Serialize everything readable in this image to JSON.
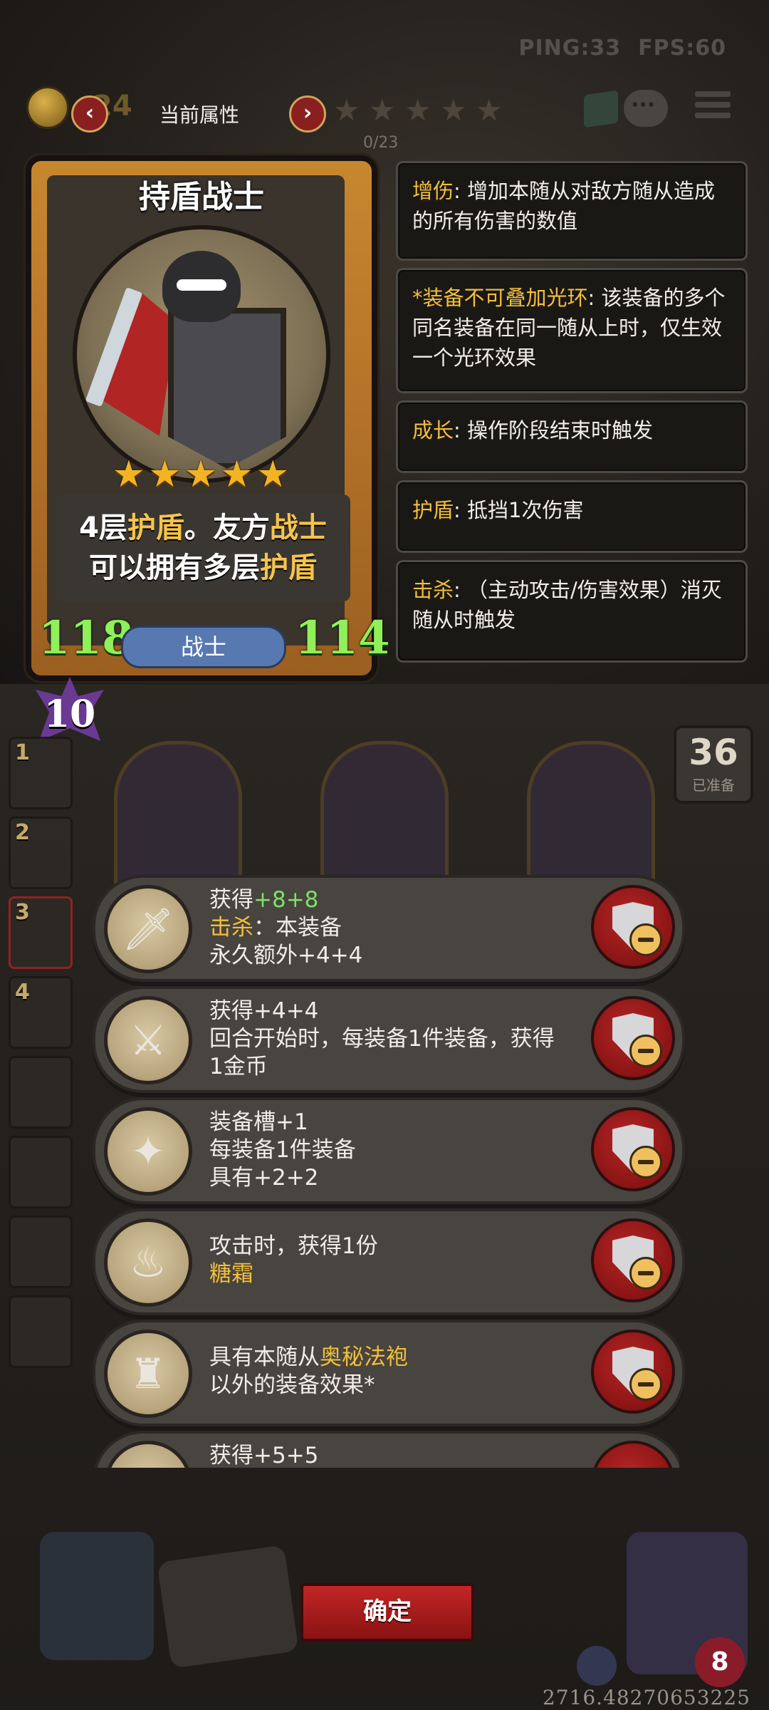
{
  "status": {
    "ping": "PING:33",
    "fps": "FPS:60"
  },
  "header": {
    "gold": "24",
    "title": "当前属性",
    "prev": "‹",
    "next": "›",
    "progress": "0/23"
  },
  "card": {
    "name": "持盾战士",
    "stars": 5,
    "desc_line1": [
      "4层",
      "护盾",
      "。友方",
      "战士"
    ],
    "desc_line2": [
      "可以拥有多层",
      "护盾"
    ],
    "attack": "118",
    "health": "114",
    "class": "战士"
  },
  "keywords": [
    {
      "key": "增伤",
      "text": ": 增加本随从对敌方随从造成的所有伤害的数值"
    },
    {
      "key": "*装备不可叠加光环",
      "text": ": 该装备的多个同名装备在同一随从上时，仅生效一个光环效果"
    },
    {
      "key": "成长",
      "text": ": 操作阶段结束时触发"
    },
    {
      "key": "护盾",
      "text": ": 抵挡1次伤害"
    },
    {
      "key": "击杀",
      "text": ": （主动攻击/伤害效果）消灭随从时触发"
    }
  ],
  "board": {
    "level": "10",
    "ready_count": "36",
    "ready_label": "已准备",
    "slots": [
      "1",
      "2",
      "3",
      "4",
      "",
      "",
      "",
      ""
    ]
  },
  "equipment": [
    {
      "icon": "flame-sword-icon",
      "lines": [
        [
          "获得",
          "+8+8"
        ],
        [
          "击杀",
          "：本装备"
        ],
        [
          "永久额外",
          "+4+4"
        ]
      ]
    },
    {
      "icon": "golden-sword-icon",
      "lines": [
        [
          "获得",
          "+4+4"
        ],
        [
          "回合开始时，每装备1件装备，获得",
          ""
        ],
        [
          "1金币",
          ""
        ]
      ]
    },
    {
      "icon": "spiked-gauntlet-icon",
      "lines": [
        [
          "装备槽",
          "+1"
        ],
        [
          "每装备1件装备",
          ""
        ],
        [
          "具有",
          "+2+2"
        ]
      ]
    },
    {
      "icon": "spoon-icon",
      "lines": [
        [
          "攻击时，获得1份",
          ""
        ],
        [
          "糖霜",
          ""
        ]
      ]
    },
    {
      "icon": "arcane-robe-icon",
      "lines": [
        [
          "具有本随从",
          "奥秘法袍"
        ],
        [
          "以外的装备效果*",
          ""
        ]
      ]
    },
    {
      "icon": "item-icon",
      "lines": [
        [
          "获得",
          "+5+5"
        ]
      ]
    }
  ],
  "footer": {
    "confirm": "确定",
    "lives": "8",
    "coordinate": "2716.48270653225"
  },
  "colors": {
    "accent_gold": "#f3bf3c",
    "stat_green": "#8ff05a",
    "confirm_red": "#c22626",
    "class_blue": "#5878b2"
  }
}
